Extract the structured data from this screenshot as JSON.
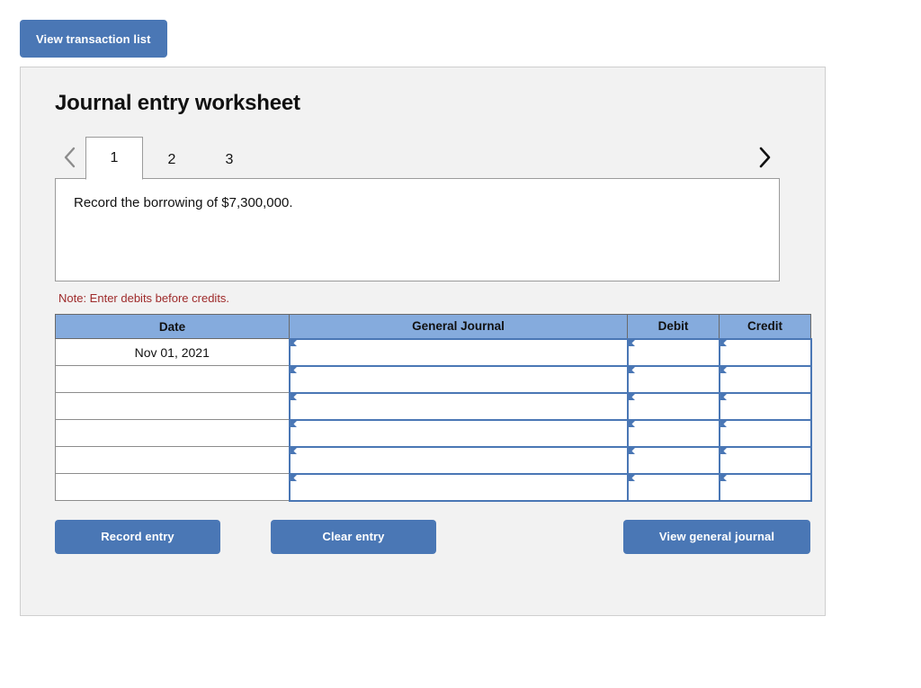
{
  "top": {
    "view_transaction_list_label": "View transaction list"
  },
  "worksheet": {
    "title": "Journal entry worksheet",
    "prev_icon": "chevron-left-icon",
    "next_icon": "chevron-right-icon",
    "tabs": [
      {
        "label": "1",
        "active": true
      },
      {
        "label": "2",
        "active": false
      },
      {
        "label": "3",
        "active": false
      }
    ],
    "prompt_text": "Record the borrowing of $7,300,000.",
    "note": "Note: Enter debits before credits."
  },
  "table": {
    "headers": [
      "Date",
      "General Journal",
      "Debit",
      "Credit"
    ],
    "rows": [
      {
        "date": "Nov 01, 2021",
        "general_journal": "",
        "debit": "",
        "credit": ""
      },
      {
        "date": "",
        "general_journal": "",
        "debit": "",
        "credit": ""
      },
      {
        "date": "",
        "general_journal": "",
        "debit": "",
        "credit": ""
      },
      {
        "date": "",
        "general_journal": "",
        "debit": "",
        "credit": ""
      },
      {
        "date": "",
        "general_journal": "",
        "debit": "",
        "credit": ""
      },
      {
        "date": "",
        "general_journal": "",
        "debit": "",
        "credit": ""
      }
    ]
  },
  "footer": {
    "record_entry_label": "Record entry",
    "clear_entry_label": "Clear entry",
    "view_general_journal_label": "View general journal"
  },
  "colors": {
    "button_blue": "#4a77b5",
    "header_blue": "#85abdd",
    "note_red": "#9e2a2a",
    "panel_gray": "#f2f2f2"
  }
}
